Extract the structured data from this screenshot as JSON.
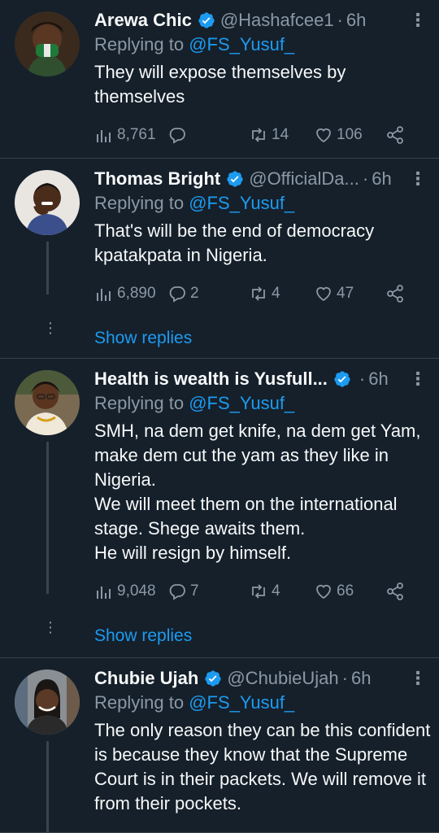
{
  "tweets": [
    {
      "name": "Arewa Chic",
      "handle": "@Hashafcee1",
      "time": "6h",
      "replying_label": "Replying to",
      "replying_to": "@FS_Yusuf_",
      "text": "They will expose themselves by themselves",
      "views": "8,761",
      "replies": "",
      "retweets": "14",
      "likes": "106",
      "show_replies": ""
    },
    {
      "name": "Thomas Bright",
      "handle": "@OfficialDa...",
      "time": "6h",
      "replying_label": "Replying to",
      "replying_to": "@FS_Yusuf_",
      "text": "That's will be the end of democracy kpatakpata in Nigeria.",
      "views": "6,890",
      "replies": "2",
      "retweets": "4",
      "likes": "47",
      "show_replies": "Show replies"
    },
    {
      "name": "Health is wealth is Yusfull...",
      "handle": "",
      "time": "6h",
      "replying_label": "Replying to",
      "replying_to": "@FS_Yusuf_",
      "text_lines": [
        "SMH, na dem get knife, na dem get Yam, make dem cut the yam as they like in Nigeria.",
        "We will meet them on the international stage. Shege awaits them.",
        "He will resign by himself."
      ],
      "views": "9,048",
      "replies": "7",
      "retweets": "4",
      "likes": "66",
      "show_replies": "Show replies"
    },
    {
      "name": "Chubie Ujah",
      "handle": "@ChubieUjah",
      "time": "6h",
      "replying_label": "Replying to",
      "replying_to": "@FS_Yusuf_",
      "text": "The only reason they can be this confident is because they know that the Supreme Court is in their packets. We will remove it from their pockets."
    }
  ],
  "time_separator": "·",
  "more_glyph": "⋮",
  "colors": {
    "background": "#15202b",
    "accent": "#1d9bf0",
    "muted": "#8b98a5",
    "border": "#38444d"
  }
}
